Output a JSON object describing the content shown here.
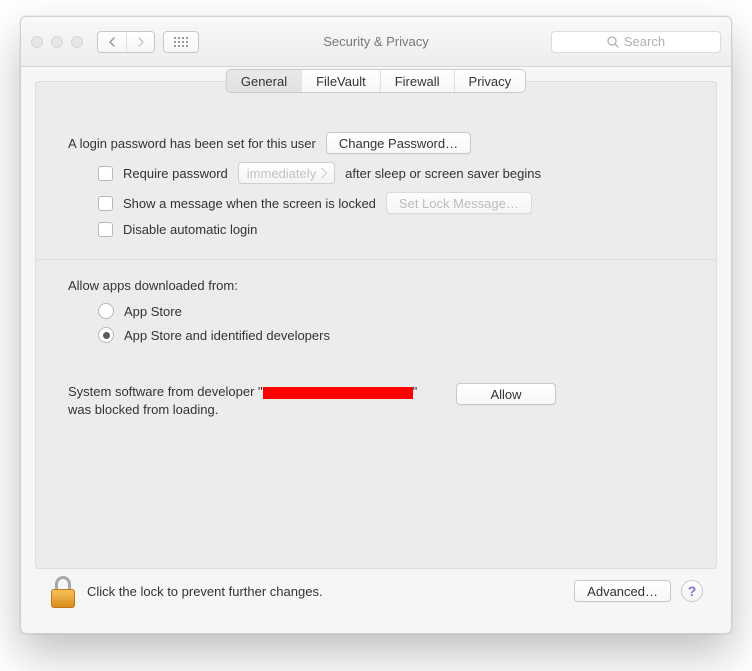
{
  "window": {
    "title": "Security & Privacy"
  },
  "search": {
    "placeholder": "Search"
  },
  "tabs": [
    "General",
    "FileVault",
    "Firewall",
    "Privacy"
  ],
  "active_tab": "General",
  "login": {
    "text": "A login password has been set for this user",
    "change_btn": "Change Password…",
    "require_label_pre": "Require password",
    "require_select": "immediately",
    "require_label_post": "after sleep or screen saver begins",
    "show_msg_label": "Show a message when the screen is locked",
    "set_lock_btn": "Set Lock Message…",
    "disable_auto_label": "Disable automatic login"
  },
  "allow": {
    "heading": "Allow apps downloaded from:",
    "opt1": "App Store",
    "opt2": "App Store and identified developers",
    "selected": "opt2"
  },
  "blocked": {
    "pre": "System software from developer \"",
    "post": "\" was blocked from loading.",
    "allow_btn": "Allow"
  },
  "footer": {
    "lock_text": "Click the lock to prevent further changes.",
    "advanced_btn": "Advanced…",
    "help": "?"
  }
}
